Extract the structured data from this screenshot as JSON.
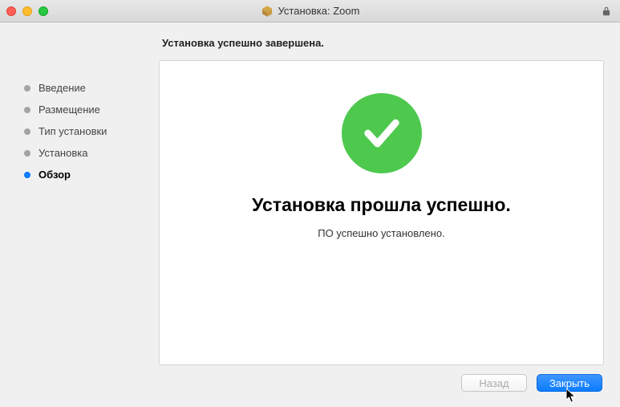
{
  "window": {
    "title": "Установка: Zoom"
  },
  "sidebar": {
    "items": [
      {
        "label": "Введение"
      },
      {
        "label": "Размещение"
      },
      {
        "label": "Тип установки"
      },
      {
        "label": "Установка"
      },
      {
        "label": "Обзор"
      }
    ]
  },
  "main": {
    "subtitle": "Установка успешно завершена.",
    "success_title": "Установка прошла успешно.",
    "success_subtext": "ПО успешно установлено."
  },
  "footer": {
    "back_label": "Назад",
    "close_label": "Закрыть"
  }
}
